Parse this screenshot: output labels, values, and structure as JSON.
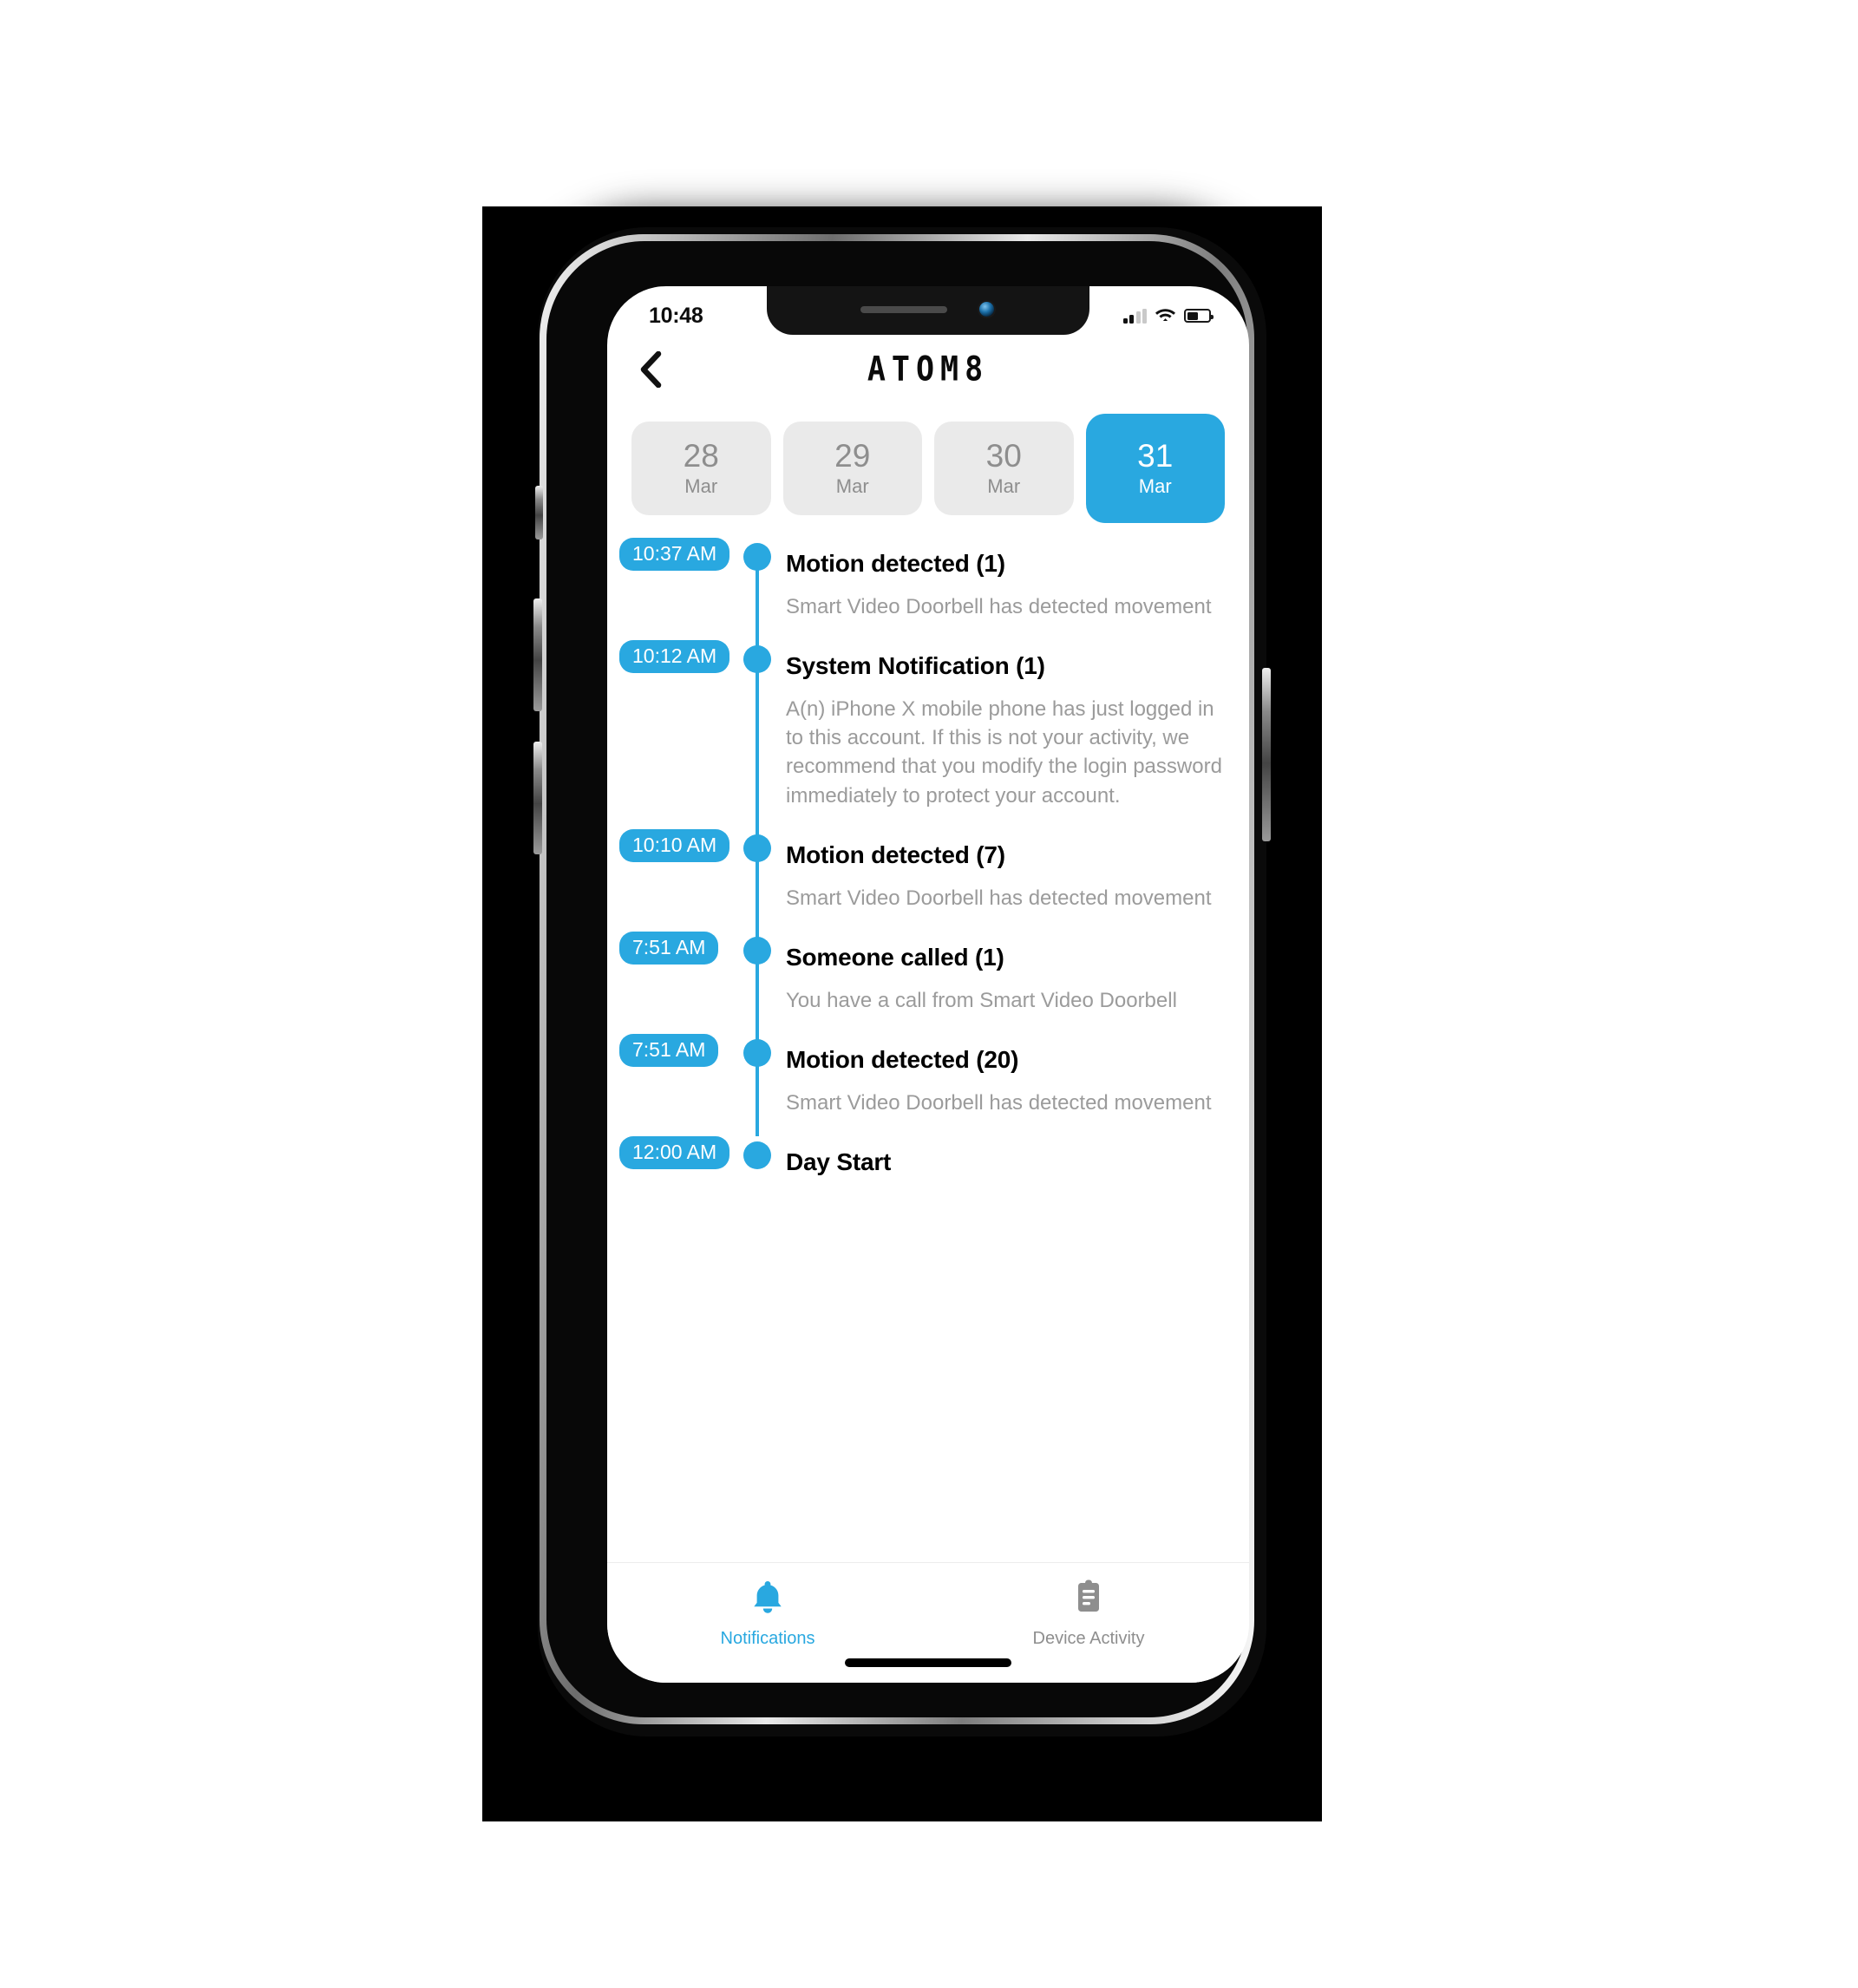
{
  "status_bar": {
    "time": "10:48",
    "signal_icon": "cellular-signal-icon",
    "wifi_icon": "wifi-icon",
    "battery_icon": "battery-icon",
    "battery_level": 52
  },
  "nav": {
    "back_icon": "back-chevron-icon",
    "brand": "ATOM8"
  },
  "dates": [
    {
      "day": "28",
      "month": "Mar",
      "selected": false
    },
    {
      "day": "29",
      "month": "Mar",
      "selected": false
    },
    {
      "day": "30",
      "month": "Mar",
      "selected": false
    },
    {
      "day": "31",
      "month": "Mar",
      "selected": true
    }
  ],
  "timeline": [
    {
      "time": "10:37 AM",
      "title": "Motion detected (1)",
      "desc": "Smart Video Doorbell has detected movement"
    },
    {
      "time": "10:12 AM",
      "title": "System Notification (1)",
      "desc": "A(n) iPhone X mobile phone has just logged in to this account. If this is not your activity, we recommend that you modify the login password immediately to protect your account."
    },
    {
      "time": "10:10 AM",
      "title": "Motion detected (7)",
      "desc": "Smart Video Doorbell has detected movement"
    },
    {
      "time": "7:51 AM",
      "title": "Someone called (1)",
      "desc": "You have a call from Smart Video Doorbell"
    },
    {
      "time": "7:51 AM",
      "title": "Motion detected (20)",
      "desc": "Smart Video Doorbell has detected movement"
    },
    {
      "time": "12:00 AM",
      "title": "Day Start",
      "desc": ""
    }
  ],
  "tabs": [
    {
      "label": "Notifications",
      "icon": "bell-icon",
      "active": true
    },
    {
      "label": "Device Activity",
      "icon": "clipboard-icon",
      "active": false
    }
  ],
  "colors": {
    "accent": "#29a8e0",
    "chip_inactive_bg": "#eaeaea",
    "muted_text": "#9b9b9b",
    "title_text": "#000000"
  }
}
